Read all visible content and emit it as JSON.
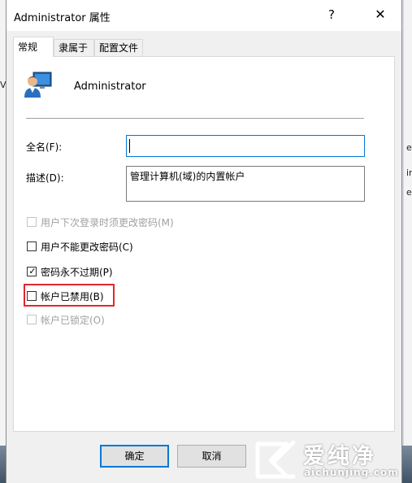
{
  "window": {
    "title": "Administrator 属性",
    "help_label": "?",
    "close_label": "✕"
  },
  "tabs": [
    {
      "label": "常规",
      "active": true
    },
    {
      "label": "隶属于",
      "active": false
    },
    {
      "label": "配置文件",
      "active": false
    }
  ],
  "general": {
    "user_name": "Administrator",
    "user_icon": "user-account-icon",
    "fullname_label": "全名(F):",
    "fullname_value": "",
    "description_label": "描述(D):",
    "description_value": "管理计算机(域)的内置帐户"
  },
  "options": [
    {
      "label": "用户下次登录时须更改密码(M)",
      "checked": false,
      "enabled": false
    },
    {
      "label": "用户不能更改密码(C)",
      "checked": false,
      "enabled": true
    },
    {
      "label": "密码永不过期(P)",
      "checked": true,
      "enabled": true
    },
    {
      "label": "帐户已禁用(B)",
      "checked": false,
      "enabled": true,
      "highlighted": true
    },
    {
      "label": "帐户已锁定(O)",
      "checked": false,
      "enabled": false
    }
  ],
  "buttons": {
    "ok_label": "确定",
    "cancel_label": "取消"
  },
  "background": {
    "right_chars": [
      "e",
      "ir",
      "e"
    ],
    "left_char": "V"
  },
  "watermark": {
    "title": "爱纯净",
    "url": "aichunjing.com"
  },
  "colors": {
    "accent": "#0078d7",
    "highlight": "#e3262e"
  }
}
